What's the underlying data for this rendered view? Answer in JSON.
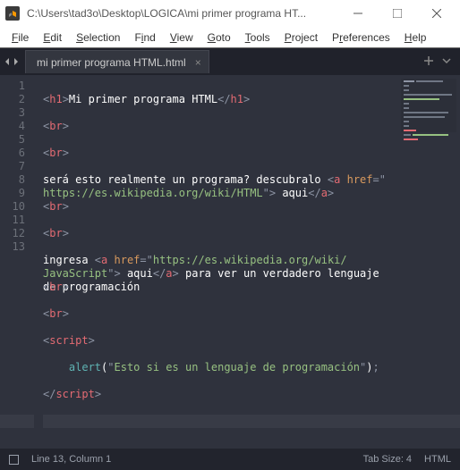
{
  "titlebar": {
    "path": "C:\\Users\\tad3o\\Desktop\\LOGICA\\mi primer programa HT..."
  },
  "menu": {
    "file": "File",
    "edit": "Edit",
    "selection": "Selection",
    "find": "Find",
    "view": "View",
    "goto": "Goto",
    "tools": "Tools",
    "project": "Project",
    "preferences": "Preferences",
    "help": "Help"
  },
  "tab": {
    "name": "mi primer programa HTML.html"
  },
  "gutter": [
    "1",
    "2",
    "3",
    "4",
    "",
    "5",
    "6",
    "7",
    "",
    "",
    "8",
    "9",
    "10",
    "11",
    "12",
    "13"
  ],
  "code": {
    "l1": {
      "o": "<",
      "t": "h1",
      "c": ">",
      "txt": "Mi primer programa HTML",
      "co": "</",
      "cc": ">"
    },
    "l2": {
      "o": "<",
      "t": "br",
      "c": ">"
    },
    "l3": {
      "o": "<",
      "t": "br",
      "c": ">"
    },
    "l4a": "será esto realmente un programa? descubralo ",
    "l4b": {
      "o": "<",
      "t": "a",
      "sp": " ",
      "a": "href",
      "eq": "=",
      "q": "\"",
      "s1": "https://es.wikipedia.org/wiki/HTML",
      "q2": "\"",
      "c": ">"
    },
    "l4c": " aqui",
    "l4d": {
      "o": "</",
      "t": "a",
      "c": ">"
    },
    "l5": {
      "o": "<",
      "t": "br",
      "c": ">"
    },
    "l6": {
      "o": "<",
      "t": "br",
      "c": ">"
    },
    "l7a": "ingresa ",
    "l7b": {
      "o": "<",
      "t": "a",
      "sp": " ",
      "a": "href",
      "eq": "=",
      "q": "\"",
      "s1": "https://es.wikipedia.org/wiki/JavaScript",
      "q2": "\"",
      "c": ">"
    },
    "l7c": " aqui",
    "l7d": {
      "o": "</",
      "t": "a",
      "c": ">"
    },
    "l7e": " para ver un verdadero lenguaje de programación",
    "l8": {
      "o": "<",
      "t": "br",
      "c": ">"
    },
    "l9": {
      "o": "<",
      "t": "br",
      "c": ">"
    },
    "l10": {
      "o": "<",
      "t": "script",
      "c": ">"
    },
    "l11": {
      "indent": "    ",
      "f": "alert",
      "op": "(",
      "q": "\"",
      "s": "Esto si es un lenguaje de programación",
      "q2": "\"",
      "cp": ")",
      "semi": ";"
    },
    "l12": {
      "o": "</",
      "t": "script",
      "c": ">"
    },
    "l13": ""
  },
  "status": {
    "pos": "Line 13, Column 1",
    "tabsize": "Tab Size: 4",
    "syntax": "HTML"
  }
}
